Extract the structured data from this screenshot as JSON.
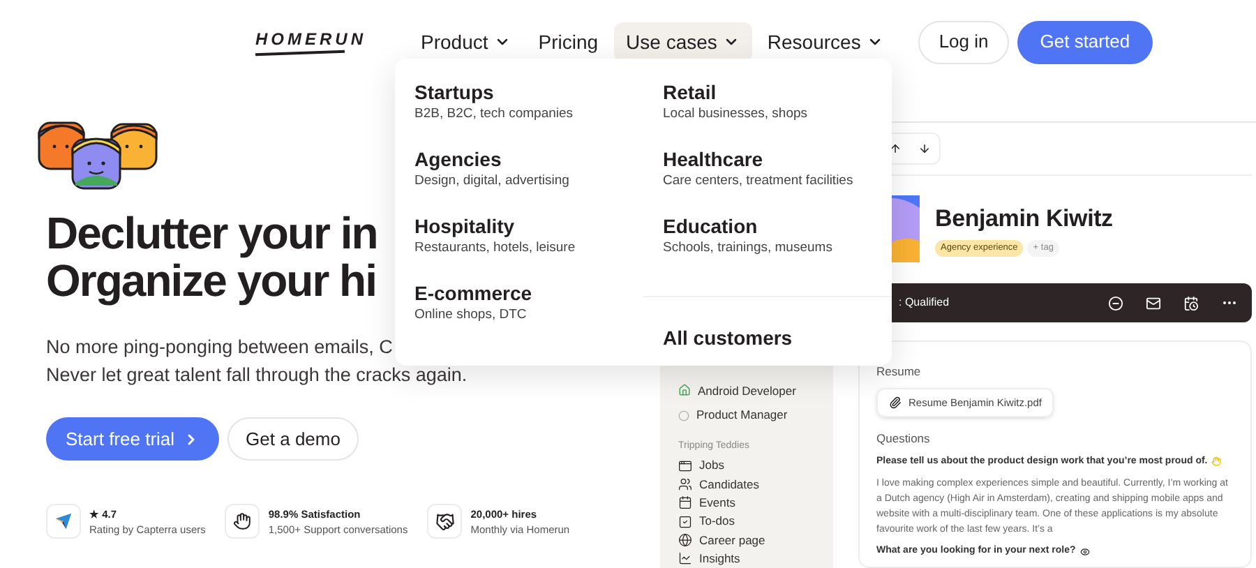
{
  "nav": {
    "logo": "HOMERUN",
    "items": [
      {
        "label": "Product",
        "has_menu": true,
        "selected": false
      },
      {
        "label": "Pricing",
        "has_menu": false,
        "selected": false
      },
      {
        "label": "Use cases",
        "has_menu": true,
        "selected": true
      },
      {
        "label": "Resources",
        "has_menu": true,
        "selected": false
      }
    ],
    "login": "Log in",
    "cta": "Get started"
  },
  "dropdown": {
    "columns": [
      [
        {
          "title": "Startups",
          "subtitle": "B2B, B2C, tech companies"
        },
        {
          "title": "Agencies",
          "subtitle": "Design, digital, advertising"
        },
        {
          "title": "Hospitality",
          "subtitle": "Restaurants, hotels, leisure"
        },
        {
          "title": "E-commerce",
          "subtitle": "Online shops, DTC"
        }
      ],
      [
        {
          "title": "Retail",
          "subtitle": "Local businesses, shops"
        },
        {
          "title": "Healthcare",
          "subtitle": "Care centers, treatment facilities"
        },
        {
          "title": "Education",
          "subtitle": "Schools, trainings, museums"
        }
      ]
    ],
    "all_customers": "All customers"
  },
  "hero": {
    "headline": [
      "Declutter your in",
      "Organize your hi"
    ],
    "paragraph": [
      "No more ping-ponging between emails, C",
      "Never let great talent fall through the cracks again."
    ],
    "primary_button": "Start free trial",
    "secondary_button": "Get a demo",
    "stats": [
      {
        "kind": "capterra",
        "title": "★ 4.7",
        "subtitle": "Rating by Capterra users"
      },
      {
        "kind": "wave",
        "title": "98.9% Satisfaction",
        "subtitle": "1,500+ Support conversations"
      },
      {
        "kind": "handshake",
        "title": "20,000+ hires",
        "subtitle": "Monthly via Homerun"
      }
    ]
  },
  "app": {
    "sidebar": {
      "jobs": [
        {
          "label": "Android Developer",
          "kind": "published"
        },
        {
          "label": "Product Manager",
          "kind": "draft"
        }
      ],
      "section": "Tripping Teddies",
      "nav": [
        {
          "label": "Jobs"
        },
        {
          "label": "Candidates"
        },
        {
          "label": "Events"
        },
        {
          "label": "To-dos"
        },
        {
          "label": "Career page"
        },
        {
          "label": "Insights"
        }
      ]
    },
    "candidate": {
      "name": "Benjamin Kiwitz",
      "tags": [
        {
          "label": "Agency experience",
          "kind": "tag"
        },
        {
          "label": "+ tag",
          "kind": "add"
        }
      ]
    },
    "status": ": Qualified",
    "resume": {
      "heading": "Resume",
      "file": "Resume Benjamin Kiwitz.pdf"
    },
    "questions": {
      "heading": "Questions",
      "items": [
        {
          "kind": "question",
          "text": "Please tell us about the product design work that you’re most proud of."
        },
        {
          "kind": "answer",
          "text": "I love making complex experiences simple and beautiful. Currently, I’m working at a Dutch agency (High Air in Amsterdam), creating and shipping mobile apps and website with a multi-disciplinary team. One of these applications is my absolute favourite work of the last few years. It’s a"
        },
        {
          "kind": "question",
          "text": "What are you looking for in your next role?"
        }
      ]
    }
  }
}
